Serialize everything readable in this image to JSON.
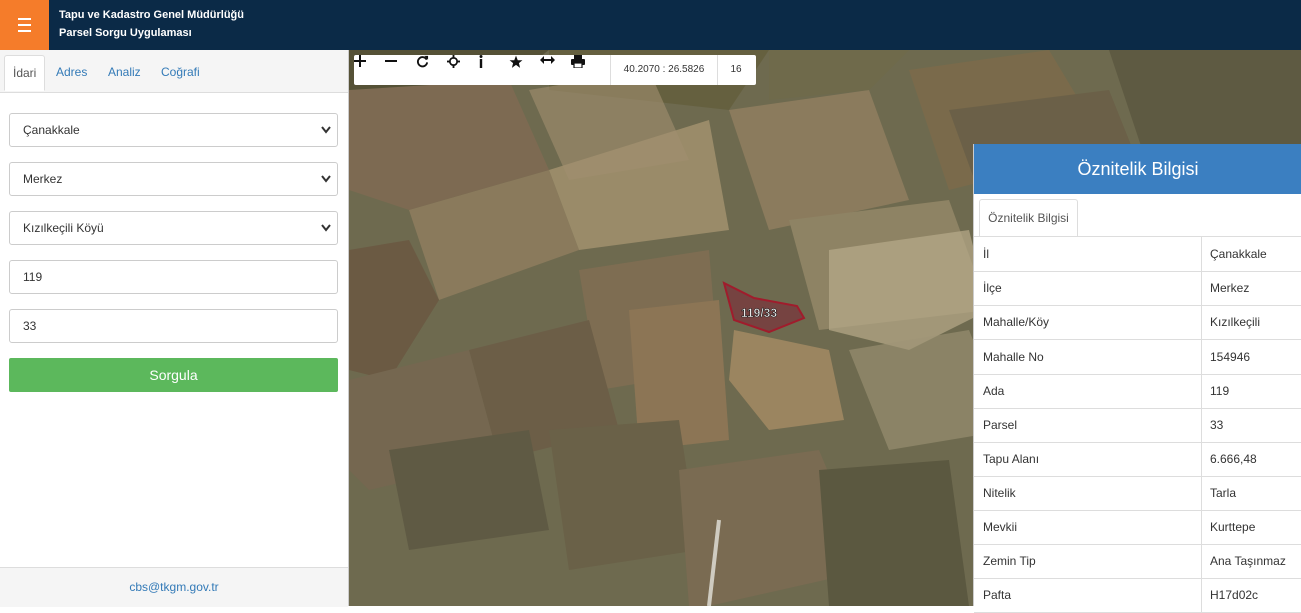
{
  "header": {
    "title_line1": "Tapu ve Kadastro Genel Müdürlüğü",
    "title_line2": "Parsel Sorgu Uygulaması",
    "menu_icon": "hamburger-icon"
  },
  "sidebar": {
    "tabs": [
      "İdari",
      "Adres",
      "Analiz",
      "Coğrafi"
    ],
    "active_tab": "İdari",
    "fields": [
      {
        "value": "Çanakkale",
        "type": "select"
      },
      {
        "value": "Merkez",
        "type": "select"
      },
      {
        "value": "Kızılkeçili Köyü",
        "type": "select"
      },
      {
        "value": "119",
        "type": "input"
      },
      {
        "value": "33",
        "type": "input"
      }
    ],
    "query_button": "Sorgula",
    "footer_email": "cbs@tkgm.gov.tr"
  },
  "map": {
    "coordinates": "40.2070 : 26.5826",
    "zoom": "16",
    "parcel_label": "119/33",
    "tools": [
      "plus-icon",
      "minus-icon",
      "refresh-icon",
      "crosshair-icon",
      "info-icon",
      "star-icon",
      "measure-icon",
      "print-icon"
    ]
  },
  "attribute_panel": {
    "title": "Öznitelik Bilgisi",
    "tab": "Öznitelik Bilgisi",
    "rows": [
      {
        "key": "İl",
        "value": "Çanakkale"
      },
      {
        "key": "İlçe",
        "value": "Merkez"
      },
      {
        "key": "Mahalle/Köy",
        "value": "Kızılkeçili"
      },
      {
        "key": "Mahalle No",
        "value": "154946"
      },
      {
        "key": "Ada",
        "value": "119"
      },
      {
        "key": "Parsel",
        "value": "33"
      },
      {
        "key": "Tapu Alanı",
        "value": "6.666,48"
      },
      {
        "key": "Nitelik",
        "value": "Tarla"
      },
      {
        "key": "Mevkii",
        "value": "Kurttepe"
      },
      {
        "key": "Zemin Tip",
        "value": "Ana Taşınmaz"
      },
      {
        "key": "Pafta",
        "value": "H17d02c"
      }
    ]
  },
  "colors": {
    "header_bg": "#0b2a47",
    "menu_bg": "#f57c2a",
    "query_button": "#5cb85c",
    "panel_head": "#3b7fc1",
    "parcel_outline": "#a01c2c"
  }
}
